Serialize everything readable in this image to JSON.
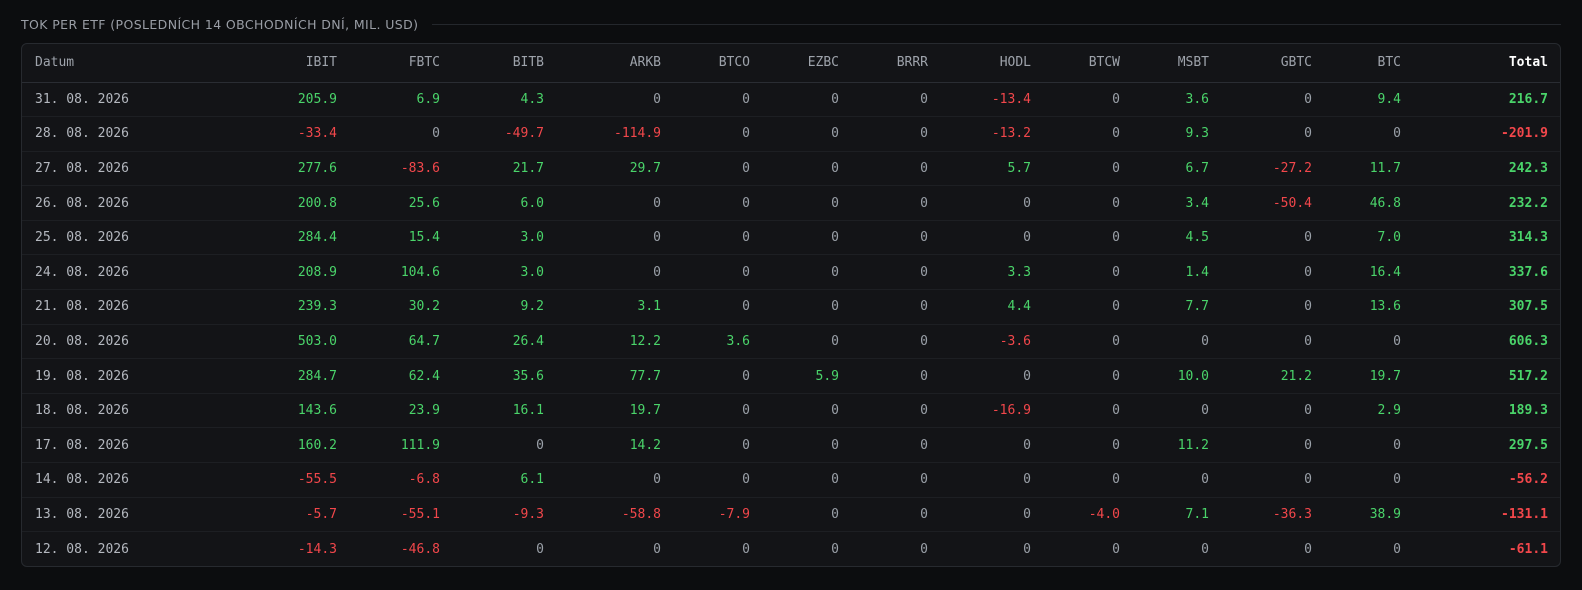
{
  "section": {
    "title": "TOK PER ETF (POSLEDNÍCH 14 OBCHODNÍCH DNÍ, MIL. USD)"
  },
  "colors": {
    "positive": "#4ad46a",
    "negative": "#f2474b",
    "neutral": "#9aa0a8"
  },
  "table": {
    "headers": [
      "Datum",
      "IBIT",
      "FBTC",
      "BITB",
      "ARKB",
      "BTCO",
      "EZBC",
      "BRRR",
      "HODL",
      "BTCW",
      "MSBT",
      "GBTC",
      "BTC",
      "Total"
    ],
    "rows": [
      [
        "31. 08. 2026",
        "205.9",
        "6.9",
        "4.3",
        "0",
        "0",
        "0",
        "0",
        "-13.4",
        "0",
        "3.6",
        "0",
        "9.4",
        "216.7"
      ],
      [
        "28. 08. 2026",
        "-33.4",
        "0",
        "-49.7",
        "-114.9",
        "0",
        "0",
        "0",
        "-13.2",
        "0",
        "9.3",
        "0",
        "0",
        "-201.9"
      ],
      [
        "27. 08. 2026",
        "277.6",
        "-83.6",
        "21.7",
        "29.7",
        "0",
        "0",
        "0",
        "5.7",
        "0",
        "6.7",
        "-27.2",
        "11.7",
        "242.3"
      ],
      [
        "26. 08. 2026",
        "200.8",
        "25.6",
        "6.0",
        "0",
        "0",
        "0",
        "0",
        "0",
        "0",
        "3.4",
        "-50.4",
        "46.8",
        "232.2"
      ],
      [
        "25. 08. 2026",
        "284.4",
        "15.4",
        "3.0",
        "0",
        "0",
        "0",
        "0",
        "0",
        "0",
        "4.5",
        "0",
        "7.0",
        "314.3"
      ],
      [
        "24. 08. 2026",
        "208.9",
        "104.6",
        "3.0",
        "0",
        "0",
        "0",
        "0",
        "3.3",
        "0",
        "1.4",
        "0",
        "16.4",
        "337.6"
      ],
      [
        "21. 08. 2026",
        "239.3",
        "30.2",
        "9.2",
        "3.1",
        "0",
        "0",
        "0",
        "4.4",
        "0",
        "7.7",
        "0",
        "13.6",
        "307.5"
      ],
      [
        "20. 08. 2026",
        "503.0",
        "64.7",
        "26.4",
        "12.2",
        "3.6",
        "0",
        "0",
        "-3.6",
        "0",
        "0",
        "0",
        "0",
        "606.3"
      ],
      [
        "19. 08. 2026",
        "284.7",
        "62.4",
        "35.6",
        "77.7",
        "0",
        "5.9",
        "0",
        "0",
        "0",
        "10.0",
        "21.2",
        "19.7",
        "517.2"
      ],
      [
        "18. 08. 2026",
        "143.6",
        "23.9",
        "16.1",
        "19.7",
        "0",
        "0",
        "0",
        "-16.9",
        "0",
        "0",
        "0",
        "2.9",
        "189.3"
      ],
      [
        "17. 08. 2026",
        "160.2",
        "111.9",
        "0",
        "14.2",
        "0",
        "0",
        "0",
        "0",
        "0",
        "11.2",
        "0",
        "0",
        "297.5"
      ],
      [
        "14. 08. 2026",
        "-55.5",
        "-6.8",
        "6.1",
        "0",
        "0",
        "0",
        "0",
        "0",
        "0",
        "0",
        "0",
        "0",
        "-56.2"
      ],
      [
        "13. 08. 2026",
        "-5.7",
        "-55.1",
        "-9.3",
        "-58.8",
        "-7.9",
        "0",
        "0",
        "0",
        "-4.0",
        "7.1",
        "-36.3",
        "38.9",
        "-131.1"
      ],
      [
        "12. 08. 2026",
        "-14.3",
        "-46.8",
        "0",
        "0",
        "0",
        "0",
        "0",
        "0",
        "0",
        "0",
        "0",
        "0",
        "-61.1"
      ]
    ]
  }
}
